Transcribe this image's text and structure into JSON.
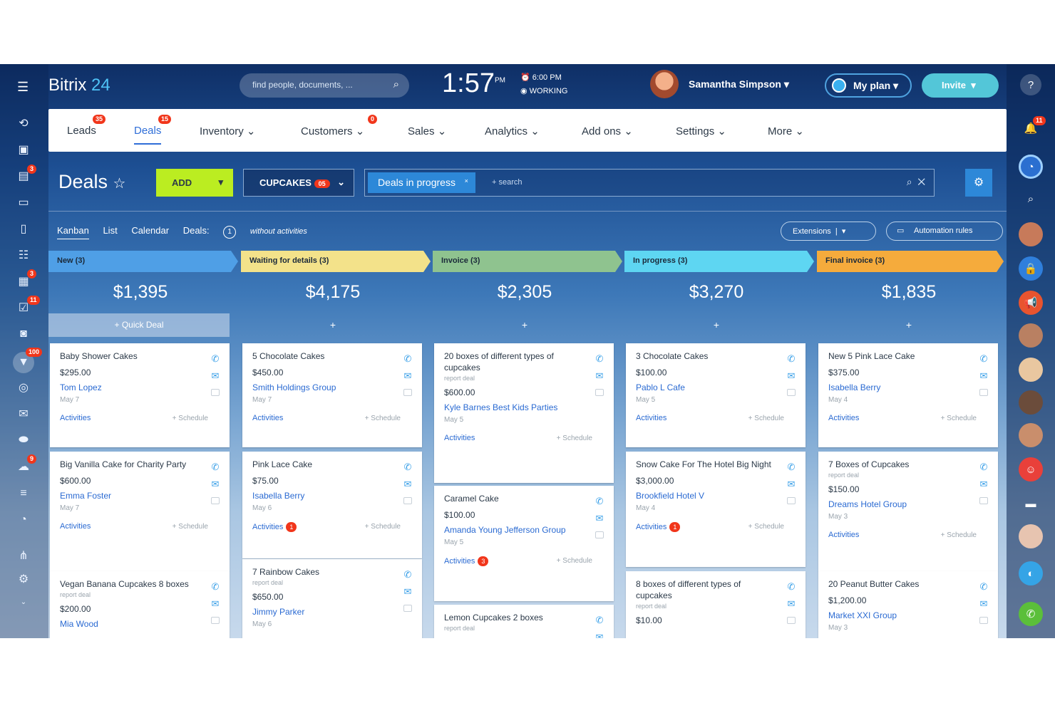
{
  "header": {
    "logo_main": "Bitrix",
    "logo_num": "24",
    "search_placeholder": "find people, documents, ...",
    "clock_time": "1:57",
    "clock_ampm": "PM",
    "alarm_time": "6:00 PM",
    "status": "WORKING",
    "user_name": "Samantha Simpson",
    "myplan_label": "My plan",
    "invite_label": "Invite"
  },
  "nav": {
    "items": [
      {
        "label": "Leads",
        "badge": "35"
      },
      {
        "label": "Deals",
        "badge": "15"
      },
      {
        "label": "Inventory",
        "badge": ""
      },
      {
        "label": "Customers",
        "badge": "0"
      },
      {
        "label": "Sales",
        "badge": ""
      },
      {
        "label": "Analytics",
        "badge": ""
      },
      {
        "label": "Add ons",
        "badge": ""
      },
      {
        "label": "Settings",
        "badge": ""
      },
      {
        "label": "More",
        "badge": ""
      }
    ]
  },
  "toolbar": {
    "page_title": "Deals",
    "add_label": "ADD",
    "cupcakes_label": "CUPCAKES",
    "cupcakes_badge": "05",
    "filter_chip": "Deals in progress",
    "filter_search": "+ search",
    "extensions_label": "Extensions",
    "robots_label": "Automation rules"
  },
  "views": {
    "kanban": "Kanban",
    "list": "List",
    "calendar": "Calendar",
    "deals_label": "Deals:",
    "deals_count": "1",
    "without_activities": "without activities"
  },
  "columns": [
    {
      "name": "New (3)",
      "color": "#4f9fe6",
      "sum": "$1,395",
      "quick": "+ Quick Deal",
      "cards": [
        {
          "title": "Baby Shower Cakes",
          "sub": "",
          "price": "$295.00",
          "client": "Tom Lopez",
          "date": "May 7",
          "activities": "Activities",
          "count": "",
          "schedule": "+ Schedule"
        },
        {
          "title": "Big Vanilla Cake for Charity Party",
          "sub": "",
          "price": "$600.00",
          "client": "Emma Foster",
          "date": "May 7",
          "activities": "Activities",
          "count": "",
          "schedule": "+ Schedule"
        },
        {
          "title": "Vegan Banana Cupcakes 8 boxes",
          "sub": "report deal",
          "price": "$200.00",
          "client": "Mia Wood",
          "date": "",
          "activities": "",
          "count": "",
          "schedule": ""
        }
      ]
    },
    {
      "name": "Waiting for details (3)",
      "color": "#f3e28a",
      "sum": "$4,175",
      "quick": "+",
      "cards": [
        {
          "title": "5 Chocolate Cakes",
          "sub": "",
          "price": "$450.00",
          "client": "Smith Holdings Group",
          "date": "May 7",
          "activities": "Activities",
          "count": "",
          "schedule": "+ Schedule"
        },
        {
          "title": "Pink Lace Cake",
          "sub": "",
          "price": "$75.00",
          "client": "Isabella Berry",
          "date": "May 6",
          "activities": "Activities",
          "count": "1",
          "schedule": "+ Schedule"
        },
        {
          "title": "7 Rainbow Cakes",
          "sub": "report deal",
          "price": "$650.00",
          "client": "Jimmy Parker",
          "date": "May 6",
          "activities": "",
          "count": "",
          "schedule": ""
        }
      ]
    },
    {
      "name": "Invoice (3)",
      "color": "#8fc38f",
      "sum": "$2,305",
      "quick": "+",
      "cards": [
        {
          "title": "20 boxes of different types of cupcakes",
          "sub": "report deal",
          "price": "$600.00",
          "client": "Kyle Barnes Best Kids Parties",
          "date": "May 5",
          "activities": "Activities",
          "count": "",
          "schedule": "+ Schedule"
        },
        {
          "title": "Caramel Cake",
          "sub": "",
          "price": "$100.00",
          "client": "Amanda Young Jefferson Group",
          "date": "May 5",
          "activities": "Activities",
          "count": "3",
          "schedule": "+ Schedule"
        },
        {
          "title": "Lemon Cupcakes 2 boxes",
          "sub": "report deal",
          "price": "",
          "client": "",
          "date": "",
          "activities": "",
          "count": "",
          "schedule": ""
        }
      ]
    },
    {
      "name": "In progress (3)",
      "color": "#5ed6f2",
      "sum": "$3,270",
      "quick": "+",
      "cards": [
        {
          "title": "3 Chocolate Cakes",
          "sub": "",
          "price": "$100.00",
          "client": "Pablo L Cafe",
          "date": "May 5",
          "activities": "Activities",
          "count": "",
          "schedule": "+ Schedule"
        },
        {
          "title": "Snow Cake For The Hotel Big Night",
          "sub": "",
          "price": "$3,000.00",
          "client": "Brookfield Hotel V",
          "date": "May 4",
          "activities": "Activities",
          "count": "1",
          "schedule": "+ Schedule"
        },
        {
          "title": "8 boxes of different types of cupcakes",
          "sub": "report deal",
          "price": "$10.00",
          "client": "",
          "date": "",
          "activities": "",
          "count": "",
          "schedule": ""
        }
      ]
    },
    {
      "name": "Final invoice (3)",
      "color": "#f5ab3c",
      "sum": "$1,835",
      "quick": "+",
      "cards": [
        {
          "title": "New 5 Pink Lace Cake",
          "sub": "",
          "price": "$375.00",
          "client": "Isabella Berry",
          "date": "May 4",
          "activities": "Activities",
          "count": "",
          "schedule": "+ Schedule"
        },
        {
          "title": "7 Boxes of Cupcakes",
          "sub": "report deal",
          "price": "$150.00",
          "client": "Dreams Hotel Group",
          "date": "May 3",
          "activities": "Activities",
          "count": "",
          "schedule": "+ Schedule"
        },
        {
          "title": "20 Peanut Butter Cakes",
          "sub": "",
          "price": "$1,200.00",
          "client": "Market XXI Group",
          "date": "May 3",
          "activities": "",
          "count": "",
          "schedule": ""
        }
      ]
    }
  ],
  "left_sidebar_badges": {
    "chat": "3",
    "calendar": "3",
    "tasks": "11",
    "crm": "100",
    "drive": "9"
  },
  "right_sidebar_badges": {
    "notifications": "11"
  }
}
